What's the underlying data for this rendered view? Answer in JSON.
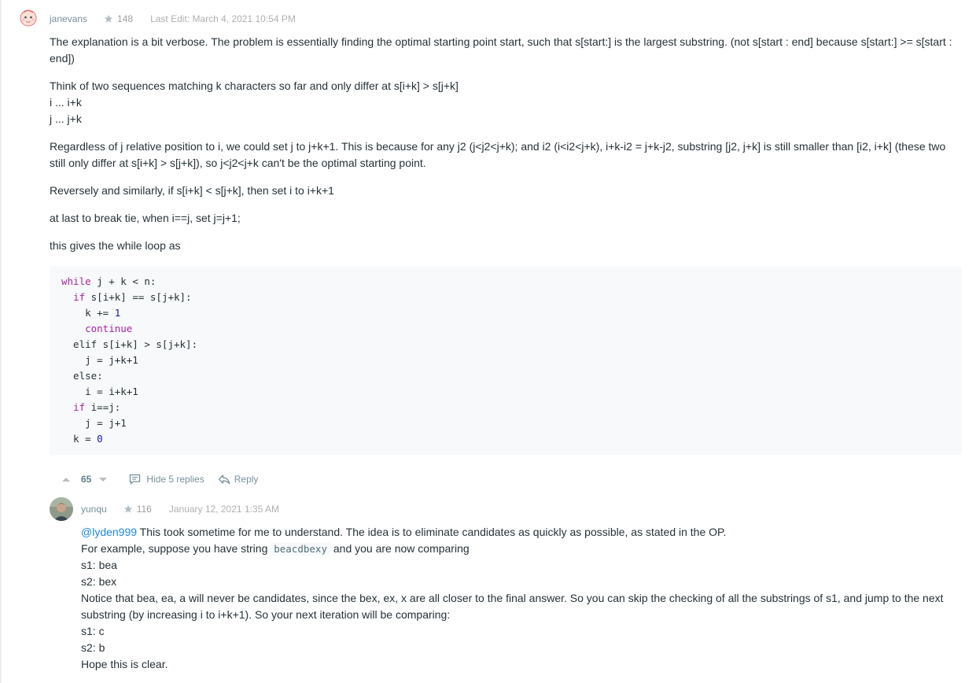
{
  "post": {
    "username": "janevans",
    "reputation": "148",
    "last_edit": "Last Edit: March 4, 2021 10:54 PM",
    "paragraphs": [
      "The explanation is a bit verbose. The problem is essentially finding the optimal starting point start, such that s[start:] is the largest substring. (not s[start : end] because s[start:] >= s[start : end])",
      "Think of two sequences matching k characters so far and only differ at s[i+k] > s[j+k]",
      "i ... i+k",
      "j ... j+k",
      "Regardless of j relative position to i, we could set j to j+k+1. This is because for any j2 (j<j2<j+k); and i2 (i<i2<j+k), i+k-i2 = j+k-j2, substring [j2, j+k] is still smaller than [i2, i+k] (these two still only differ at s[i+k] > s[j+k]), so j<j2<j+k can't be the optimal starting point.",
      "Reversely and similarly, if s[i+k] < s[j+k], then set i to i+k+1",
      "at last to break tie, when i==j, set j=j+1;",
      "this gives the while loop as"
    ],
    "code": {
      "l1_kw": "while",
      "l1_rest": " j + k < n:",
      "l2_indent": "  ",
      "l2_kw": "if",
      "l2_rest": " s[i+k] == s[j+k]:",
      "l3_text": "    k += ",
      "l3_num": "1",
      "l4_indent": "    ",
      "l4_kw": "continue",
      "l5_text": "  elif s[i+k] > s[j+k]:",
      "l6_text": "    j = j+k+1",
      "l7_text": "  else:",
      "l8_text": "    i = i+k+1",
      "l9_indent": "  ",
      "l9_kw": "if",
      "l9_rest": " i==j:",
      "l10_text": "    j = j+1",
      "l11_text": "  k = ",
      "l11_num": "0"
    },
    "votes": "65",
    "hide_replies_label": "Hide 5 replies",
    "reply_label": "Reply"
  },
  "reply": {
    "username": "yunqu",
    "reputation": "116",
    "timestamp": "January 12, 2021 1:35 AM",
    "mention": "@lyden999",
    "line1_rest": " This took sometime for me to understand. The idea is to eliminate candidates as quickly as possible, as stated in the OP.",
    "line2_pre": "For example, suppose you have string ",
    "line2_code": "beacdbexy",
    "line2_post": " and you are now comparing",
    "line3": "s1: bea",
    "line4": "s2: bex",
    "line5": "Notice that bea, ea, a will never be candidates, since the bex, ex, x are all closer to the final answer. So you can skip the checking of all the substrings of s1, and jump to the next substring (by increasing i to i+k+1). So your next iteration will be comparing:",
    "line6": "s1: c",
    "line7": "s2: b",
    "line8": "Hope this is clear."
  },
  "colors": {
    "accent_mention": "#1e88e5",
    "code_keyword": "#a626a4",
    "code_number": "#1a1aa6",
    "code_background": "#f7f9fa"
  }
}
